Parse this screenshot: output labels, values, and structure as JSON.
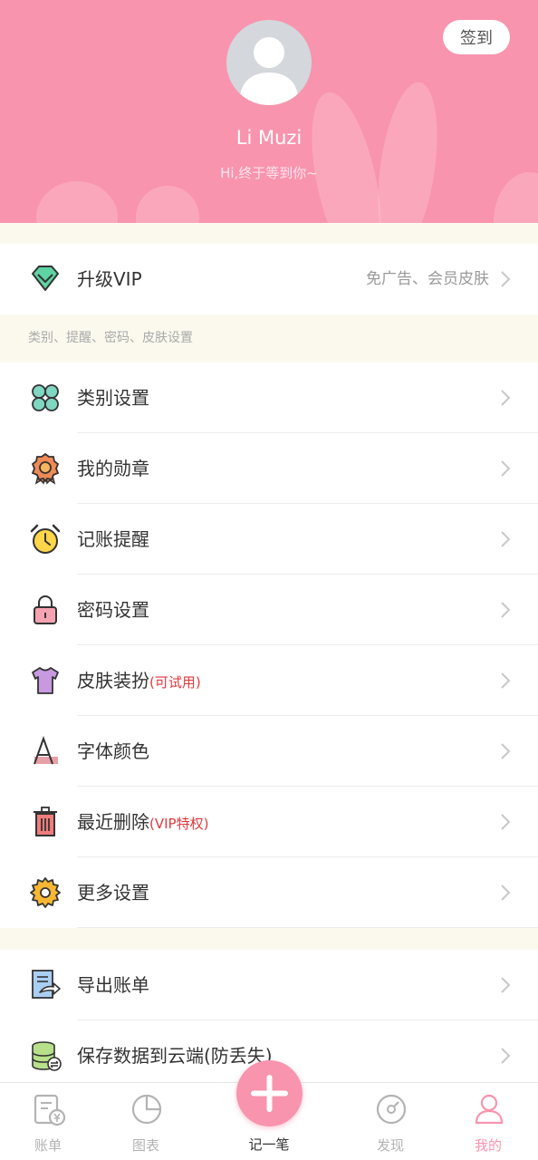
{
  "header": {
    "checkin_label": "签到",
    "username": "Li Muzi",
    "greeting": "Hi,终于等到你~"
  },
  "vip": {
    "label": "升级VIP",
    "extra": "免广告、会员皮肤"
  },
  "section_hint": "类别、提醒、密码、皮肤设置",
  "settings": [
    {
      "label": "类别设置",
      "tag": "",
      "icon": "clover-icon"
    },
    {
      "label": "我的勋章",
      "tag": "",
      "icon": "medal-icon"
    },
    {
      "label": "记账提醒",
      "tag": "",
      "icon": "alarm-clock-icon"
    },
    {
      "label": "密码设置",
      "tag": "",
      "icon": "lock-icon"
    },
    {
      "label": "皮肤装扮",
      "tag": "(可试用)",
      "icon": "shirt-icon"
    },
    {
      "label": "字体颜色",
      "tag": "",
      "icon": "font-icon"
    },
    {
      "label": "最近删除",
      "tag": "(VIP特权)",
      "icon": "trash-icon"
    },
    {
      "label": "更多设置",
      "tag": "",
      "icon": "gear-icon"
    }
  ],
  "data_section": [
    {
      "label": "导出账单",
      "icon": "export-document-icon"
    },
    {
      "label": "保存数据到云端(防丢失)",
      "icon": "database-sync-icon"
    }
  ],
  "tabbar": {
    "tabs": [
      {
        "label": "账单",
        "icon": "bill-icon"
      },
      {
        "label": "图表",
        "icon": "pie-chart-icon"
      },
      {
        "label": "记一笔",
        "icon": "plus-icon"
      },
      {
        "label": "发现",
        "icon": "compass-icon"
      },
      {
        "label": "我的",
        "icon": "person-icon"
      }
    ],
    "active_index": 4
  },
  "colors": {
    "brand_pink": "#f994ae",
    "tag_red": "#e0393e",
    "section_bg": "#fbf9ee"
  }
}
